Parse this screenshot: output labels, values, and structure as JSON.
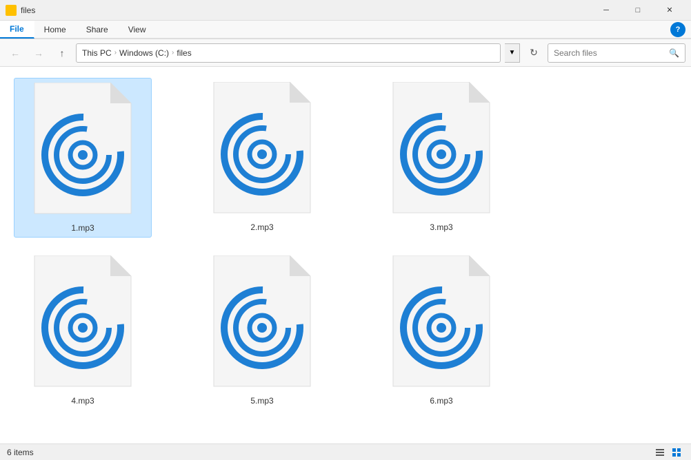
{
  "titleBar": {
    "icon": "folder-icon",
    "title": "files",
    "minimizeLabel": "─",
    "maximizeLabel": "□",
    "closeLabel": "✕"
  },
  "ribbon": {
    "tabs": [
      {
        "label": "File",
        "active": true
      },
      {
        "label": "Home",
        "active": false
      },
      {
        "label": "Share",
        "active": false
      },
      {
        "label": "View",
        "active": false
      }
    ],
    "commands": []
  },
  "addressBar": {
    "backLabel": "←",
    "forwardLabel": "→",
    "upLabel": "↑",
    "path": [
      "This PC",
      "Windows (C:)",
      "files"
    ],
    "refreshLabel": "⟳",
    "searchPlaceholder": "Search files"
  },
  "files": [
    {
      "name": "1.mp3",
      "selected": true
    },
    {
      "name": "2.mp3",
      "selected": false
    },
    {
      "name": "3.mp3",
      "selected": false
    },
    {
      "name": "4.mp3",
      "selected": false
    },
    {
      "name": "5.mp3",
      "selected": false
    },
    {
      "name": "6.mp3",
      "selected": false
    }
  ],
  "statusBar": {
    "count": "6 items"
  },
  "colors": {
    "accent": "#0078d7",
    "mp3Color": "#1e7fd4"
  }
}
